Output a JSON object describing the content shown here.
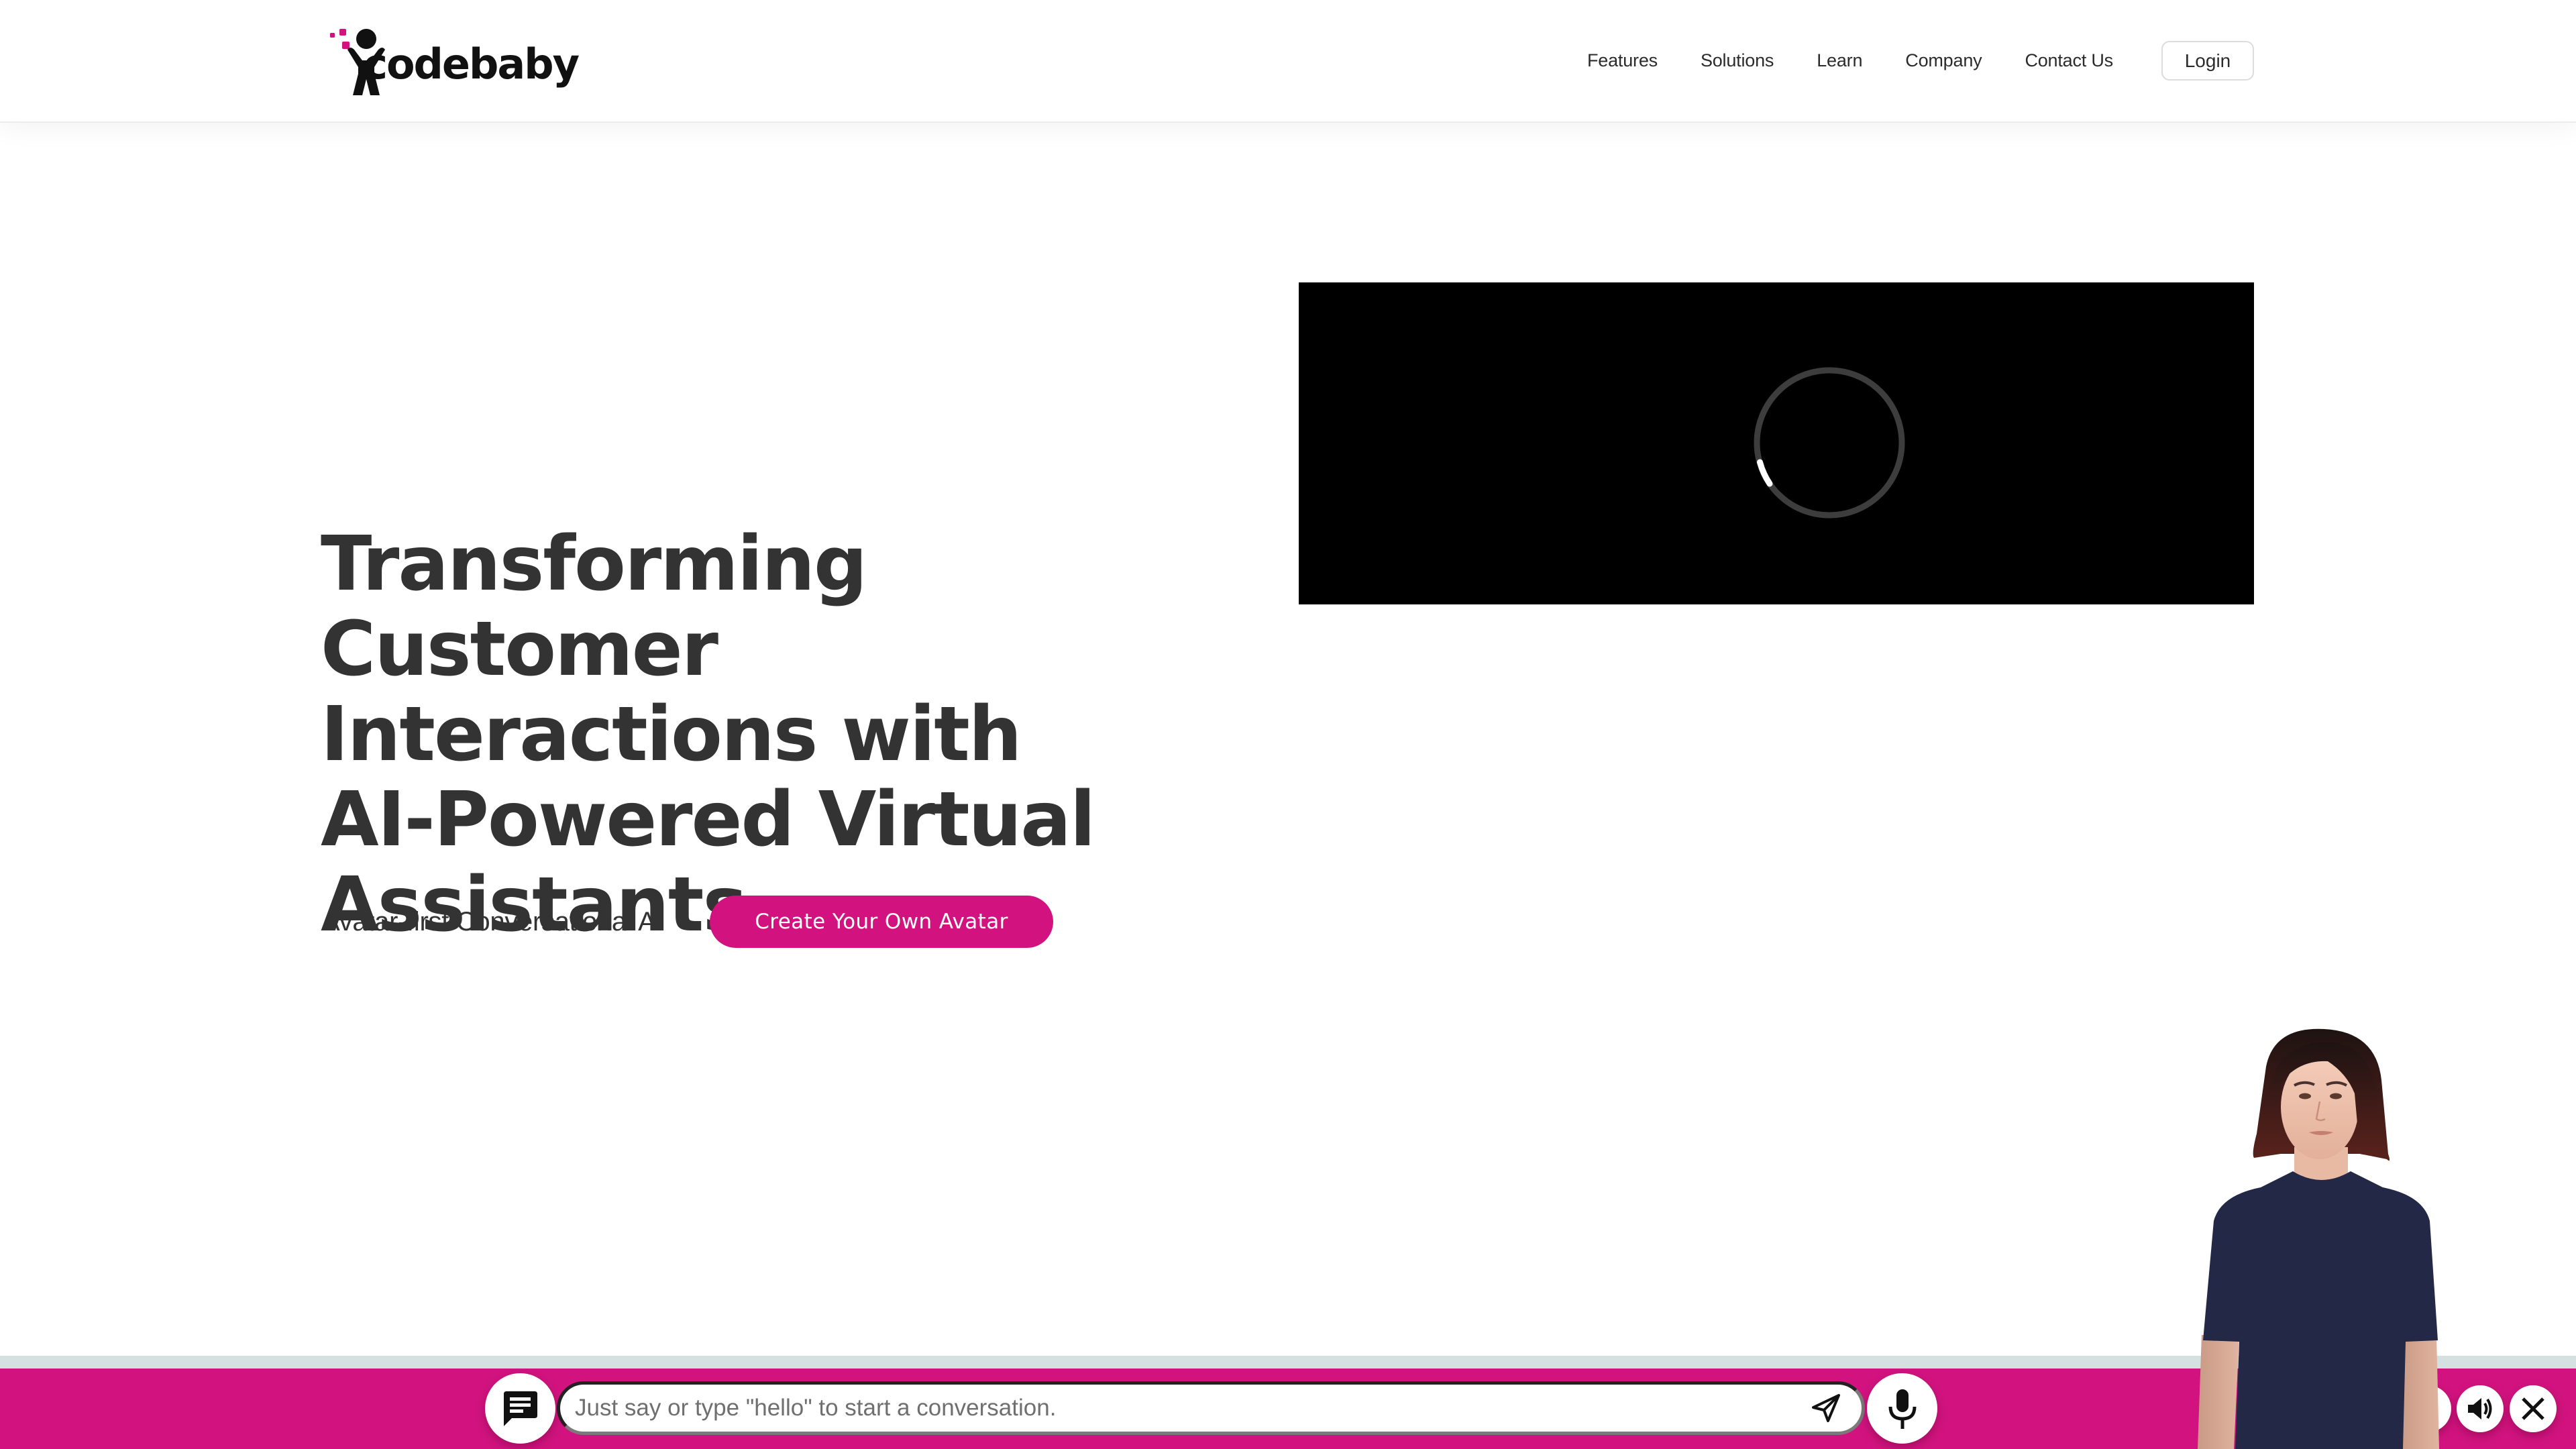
{
  "brand": {
    "name": "codebaby",
    "accent_color": "#d2137f",
    "text_color": "#333333"
  },
  "nav": {
    "items": [
      {
        "label": "Features"
      },
      {
        "label": "Solutions"
      },
      {
        "label": "Learn"
      },
      {
        "label": "Company"
      },
      {
        "label": "Contact Us"
      }
    ],
    "login_label": "Login"
  },
  "hero": {
    "title_lines": [
      "Transforming Customer",
      "Interactions with",
      "AI-Powered Virtual",
      "Assistants"
    ],
    "tagline": "Avatar-first Conversational AI",
    "cta_label": "Create Your Own Avatar"
  },
  "video": {
    "state": "loading",
    "spinner_icon": "loading-spinner-icon"
  },
  "chat_widget": {
    "bar_color": "#d2137f",
    "strip_color": "#d5e0e1",
    "input_placeholder": "Just say or type \"hello\" to start a conversation.",
    "input_value": "",
    "icons": {
      "chat_toggle": "chat-bubble-icon",
      "send": "send-icon",
      "mic": "microphone-icon",
      "speaker": "speaker-icon",
      "close": "close-icon"
    },
    "avatar": "virtual-assistant-avatar"
  }
}
